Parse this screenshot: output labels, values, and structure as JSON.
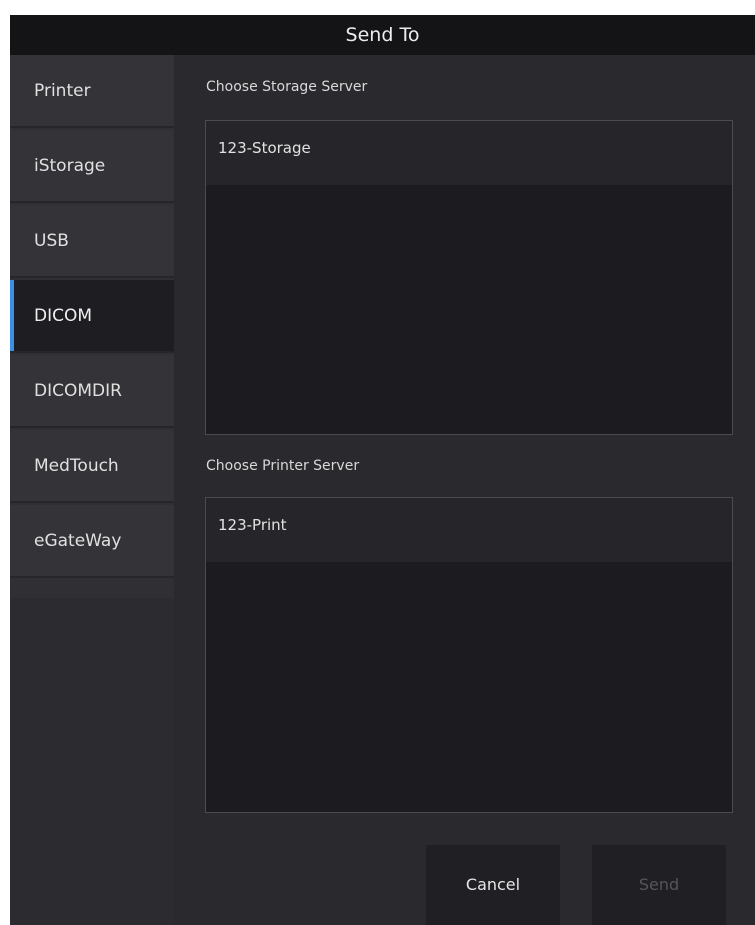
{
  "dialog": {
    "title": "Send To"
  },
  "sidebar": {
    "items": [
      {
        "label": "Printer"
      },
      {
        "label": "iStorage"
      },
      {
        "label": "USB"
      },
      {
        "label": "DICOM"
      },
      {
        "label": "DICOMDIR"
      },
      {
        "label": "MedTouch"
      },
      {
        "label": "eGateWay"
      }
    ],
    "active_index": 3
  },
  "storage": {
    "label": "Choose Storage Server",
    "servers": [
      "123-Storage"
    ]
  },
  "printer": {
    "label": "Choose Printer Server",
    "servers": [
      "123-Print"
    ]
  },
  "buttons": {
    "cancel": "Cancel",
    "send": "Send",
    "send_enabled": false
  },
  "colors": {
    "accent": "#3b8fe6",
    "titlebar_bg": "#141416",
    "panel_bg": "#2a2a2e",
    "list_bg": "#1c1c20"
  }
}
